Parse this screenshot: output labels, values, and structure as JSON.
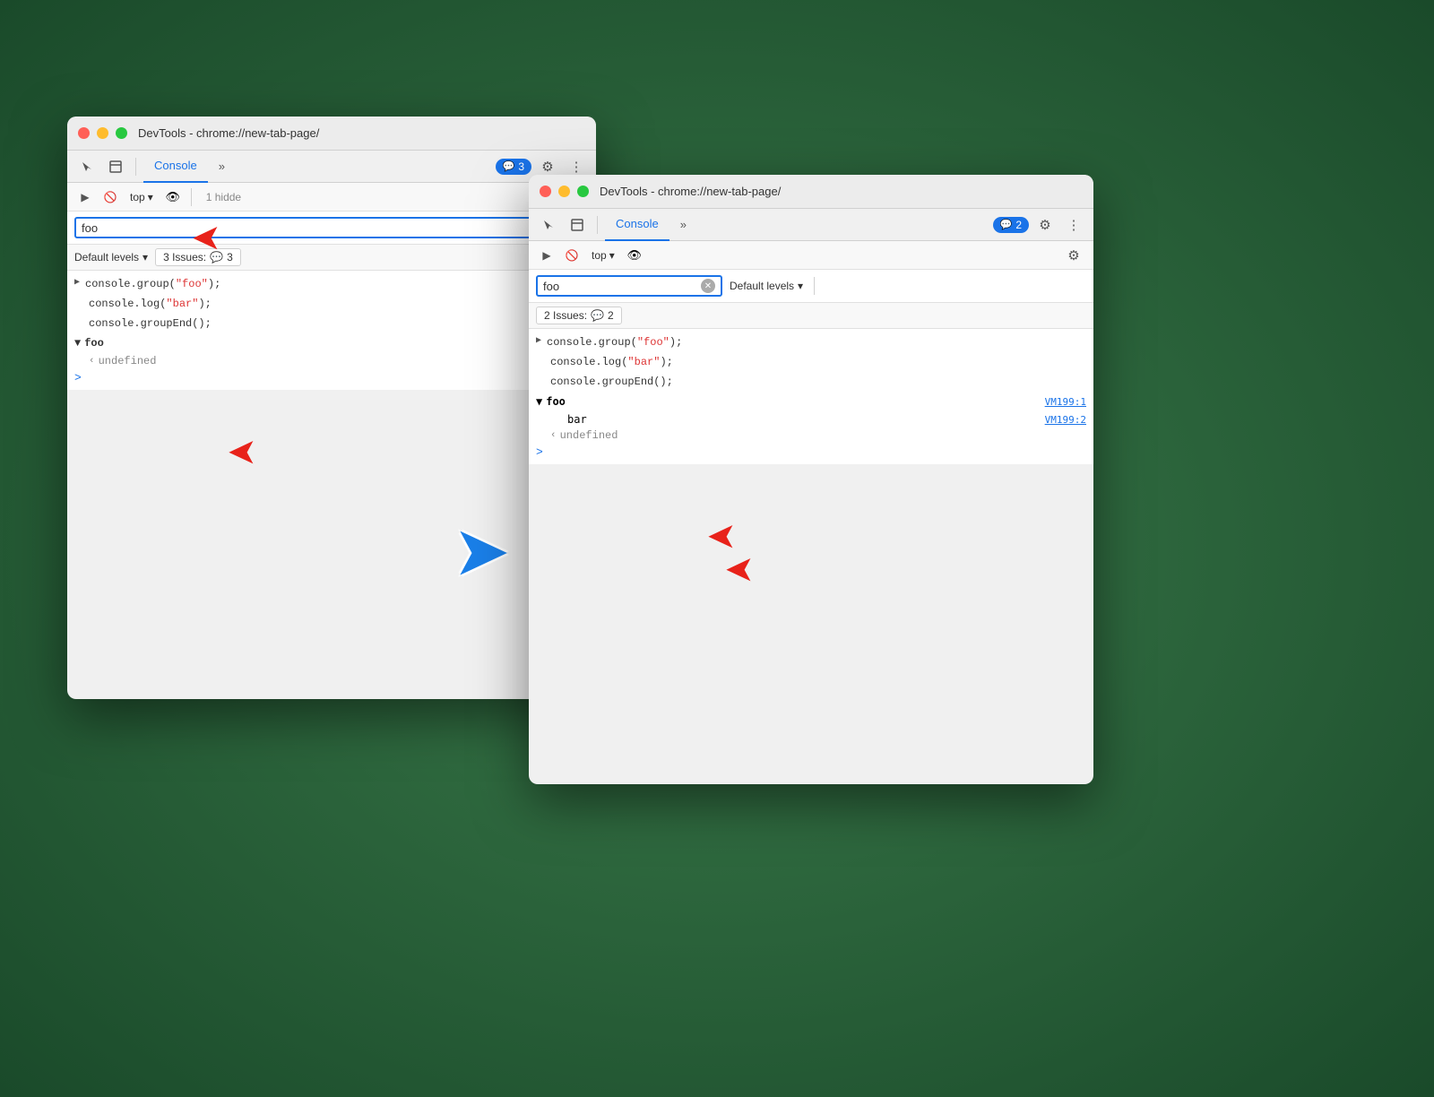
{
  "window1": {
    "title": "DevTools - chrome://new-tab-page/",
    "tab_console": "Console",
    "tab_more": "»",
    "badge_count": "3",
    "top_label": "top",
    "hidden_text": "1 hidde",
    "search_value": "foo",
    "levels_label": "Default levels",
    "issues_label": "3 Issues:",
    "issues_count": "3",
    "code_lines": [
      "console.group(\"foo\");",
      "console.log(\"bar\");",
      "console.groupEnd();"
    ],
    "group_name": "foo",
    "undefined_text": "undefined",
    "prompt": ">"
  },
  "window2": {
    "title": "DevTools - chrome://new-tab-page/",
    "tab_console": "Console",
    "tab_more": "»",
    "badge_count": "2",
    "top_label": "top",
    "search_value": "foo",
    "levels_label": "Default levels",
    "issues_label": "2 Issues:",
    "issues_count": "2",
    "code_lines": [
      "console.group(\"foo\");",
      "console.log(\"bar\");",
      "console.groupEnd();"
    ],
    "group_name": "foo",
    "bar_text": "bar",
    "vm_link1": "VM199:1",
    "vm_link2": "VM199:2",
    "undefined_text": "undefined",
    "prompt": ">"
  },
  "arrows": {
    "blue_arrow": "➤"
  }
}
